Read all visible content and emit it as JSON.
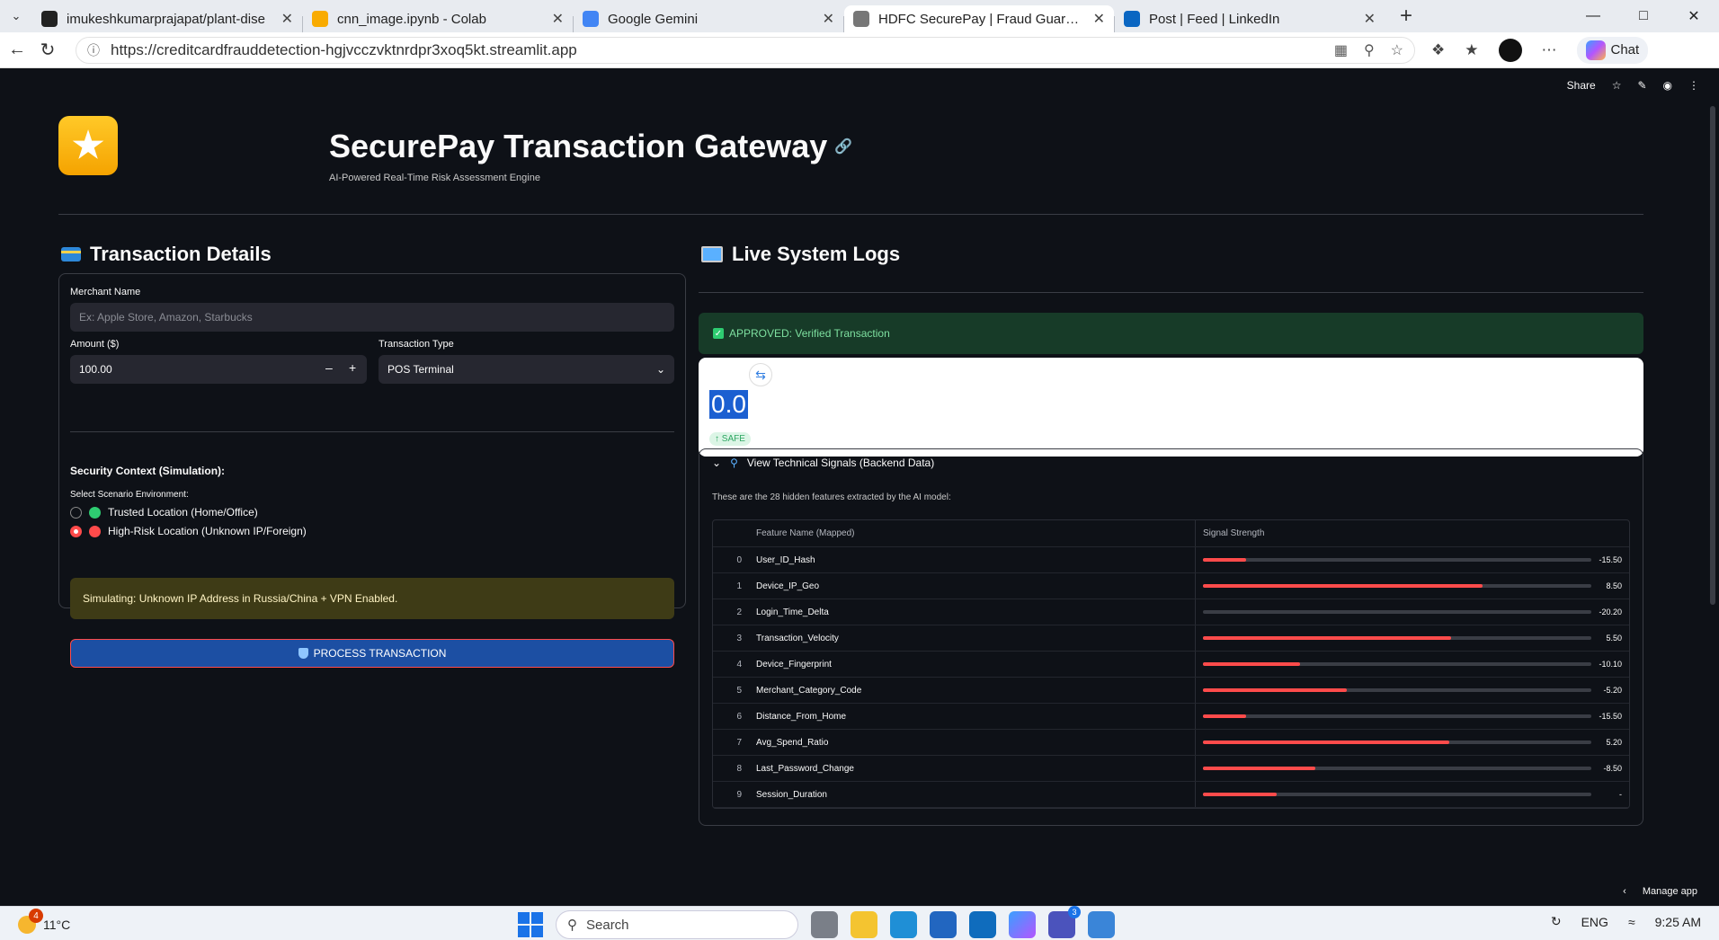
{
  "browser": {
    "tabs": [
      {
        "title": "imukeshkumarprajapat/plant-dise",
        "icon": "github-icon",
        "color": "#222222"
      },
      {
        "title": "cnn_image.ipynb - Colab",
        "icon": "colab-icon",
        "color": "#f9ab00"
      },
      {
        "title": "Google Gemini",
        "icon": "gemini-icon",
        "color": "#4285f4"
      },
      {
        "title": "HDFC SecurePay | Fraud Guard · St",
        "icon": "bank-icon",
        "color": "#777777"
      },
      {
        "title": "Post | Feed | LinkedIn",
        "icon": "linkedin-icon",
        "color": "#0a66c2"
      }
    ],
    "active_tab": 3,
    "url": "https://creditcardfrauddetection-hgjvcczvktnrdpr3xoq5kt.streamlit.app",
    "chat_label": "Chat"
  },
  "toolbar": {
    "share_label": "Share"
  },
  "header": {
    "title": "SecurePay Transaction Gateway",
    "subtitle": "AI-Powered Real-Time Risk Assessment Engine"
  },
  "form": {
    "section_title": "Transaction Details",
    "merchant_label": "Merchant Name",
    "merchant_placeholder": "Ex: Apple Store, Amazon, Starbucks",
    "amount_label": "Amount ($)",
    "amount_value": "100.00",
    "type_label": "Transaction Type",
    "type_value": "POS Terminal",
    "security_heading": "Security Context (Simulation):",
    "scenario_label": "Select Scenario Environment:",
    "options": [
      {
        "label": "Trusted Location (Home/Office)",
        "selected": false
      },
      {
        "label": "High-Risk Location (Unknown IP/Foreign)",
        "selected": true
      }
    ],
    "warning": "Simulating: Unknown IP Address in Russia/China + VPN Enabled.",
    "process_label": "PROCESS TRANSACTION"
  },
  "logs": {
    "section_title": "Live System Logs",
    "approval": "APPROVED: Verified Transaction",
    "metric_value": "0.0",
    "metric_delta": "↑ SAFE",
    "expander_title": "View Technical Signals (Backend Data)",
    "description": "These are the 28 hidden features extracted by the AI model:",
    "col_feature": "Feature Name (Mapped)",
    "col_signal": "Signal Strength",
    "rows": [
      {
        "idx": "0",
        "name": "User_ID_Hash",
        "value": "-15.50",
        "strength": 0.11
      },
      {
        "idx": "1",
        "name": "Device_IP_Geo",
        "value": "8.50",
        "strength": 0.72
      },
      {
        "idx": "2",
        "name": "Login_Time_Delta",
        "value": "-20.20",
        "strength": 0.0
      },
      {
        "idx": "3",
        "name": "Transaction_Velocity",
        "value": "5.50",
        "strength": 0.64
      },
      {
        "idx": "4",
        "name": "Device_Fingerprint",
        "value": "-10.10",
        "strength": 0.25
      },
      {
        "idx": "5",
        "name": "Merchant_Category_Code",
        "value": "-5.20",
        "strength": 0.37
      },
      {
        "idx": "6",
        "name": "Distance_From_Home",
        "value": "-15.50",
        "strength": 0.11
      },
      {
        "idx": "7",
        "name": "Avg_Spend_Ratio",
        "value": "5.20",
        "strength": 0.635
      },
      {
        "idx": "8",
        "name": "Last_Password_Change",
        "value": "-8.50",
        "strength": 0.29
      },
      {
        "idx": "9",
        "name": "Session_Duration",
        "value": "-",
        "strength": 0.19
      }
    ]
  },
  "manage_label": "Manage app",
  "taskbar": {
    "temperature": "11°C",
    "weather_badge": "4",
    "search_placeholder": "Search",
    "language": "ENG",
    "time": "9:25 AM",
    "app_badge": "3"
  }
}
